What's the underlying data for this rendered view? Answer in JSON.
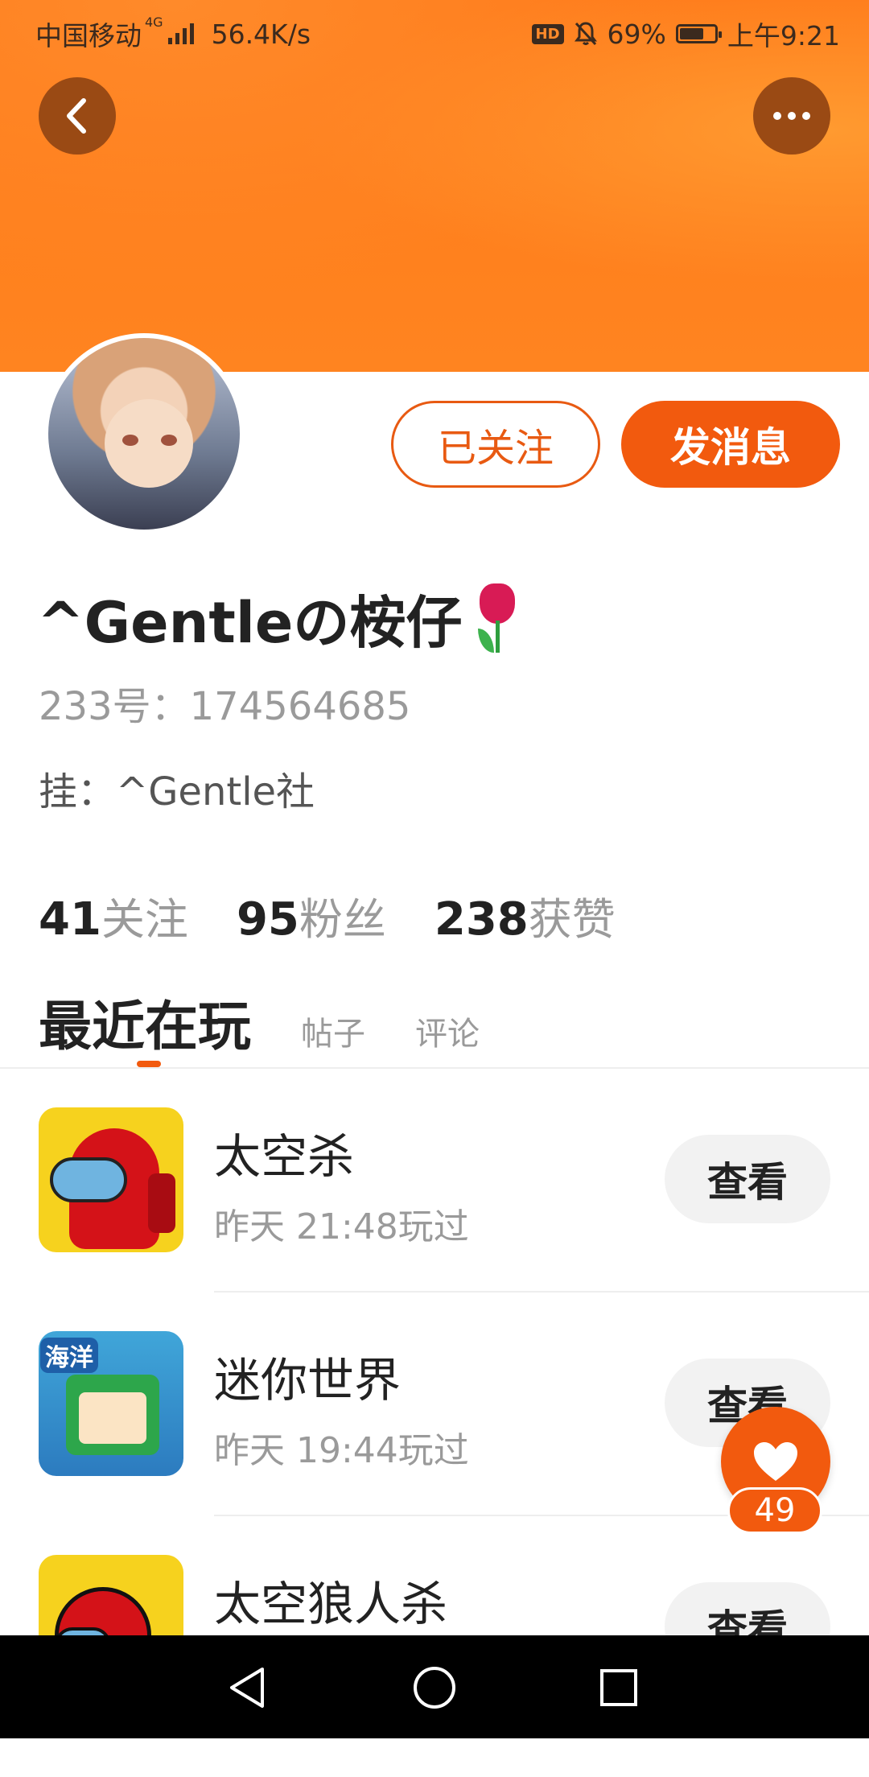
{
  "status_bar": {
    "carrier": "中国移动",
    "network": "4G",
    "speed": "56.4K/s",
    "hd": "HD",
    "battery": "69%",
    "battery_level": 0.69,
    "time": "上午9:21"
  },
  "header": {
    "back_icon": "chevron-left-icon",
    "more_icon": "more-dots-icon"
  },
  "profile": {
    "name": "^Gentleの桉仔",
    "emoji_icon": "tulip-icon",
    "uid": "233号：174564685",
    "club": "挂：^Gentle社",
    "follow_button": "已关注",
    "message_button": "发消息"
  },
  "stats": [
    {
      "num": "41",
      "label": "关注"
    },
    {
      "num": "95",
      "label": "粉丝"
    },
    {
      "num": "238",
      "label": "获赞"
    }
  ],
  "tabs": [
    {
      "label": "最近在玩",
      "active": true
    },
    {
      "label": "帖子",
      "active": false
    },
    {
      "label": "评论",
      "active": false
    }
  ],
  "games": [
    {
      "name": "太空杀",
      "time": "昨天 21:48玩过",
      "action": "查看"
    },
    {
      "name": "迷你世界",
      "time": "昨天 19:44玩过",
      "action": "查看",
      "icon_tag": "海洋"
    },
    {
      "name": "太空狼人杀",
      "time": "",
      "action": "查看"
    }
  ],
  "like_fab": {
    "icon": "heart-icon",
    "count": "49"
  },
  "colors": {
    "accent": "#f25a0e",
    "banner": "#ff7a1a"
  }
}
